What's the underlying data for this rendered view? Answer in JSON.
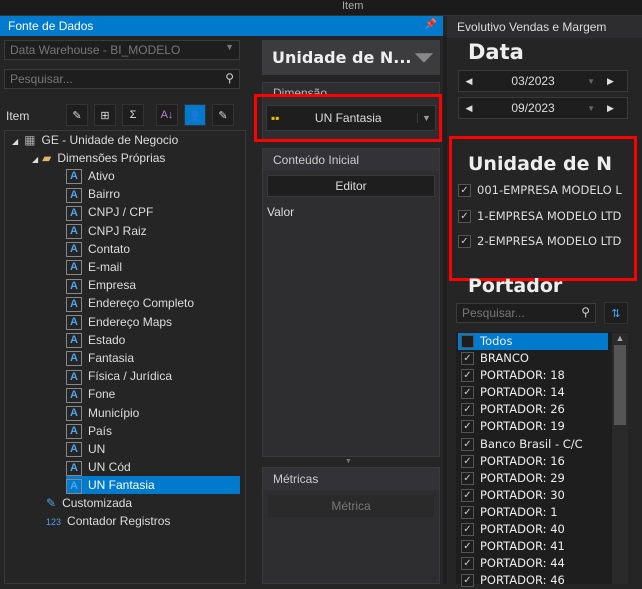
{
  "topbar": {
    "title": "Item"
  },
  "left": {
    "header": "Fonte de Dados",
    "source": "Data Warehouse - BI_MODELO",
    "search_placeholder": "Pesquisar...",
    "item_label": "Item",
    "tree": {
      "root": "GE - Unidade de Negocio",
      "folder": "Dimensões Próprias",
      "items": [
        "Ativo",
        "Bairro",
        "CNPJ / CPF",
        "CNPJ Raiz",
        "Contato",
        "E-mail",
        "Empresa",
        "Endereço Completo",
        "Endereço Maps",
        "Estado",
        "Fantasia",
        "Física / Jurídica",
        "Fone",
        "Município",
        "País",
        "UN",
        "UN Cód",
        "UN Fantasia"
      ],
      "selected": "UN Fantasia",
      "extra": [
        "Customizada",
        "Contador Registros"
      ]
    }
  },
  "middle": {
    "title": "Unidade de N...",
    "dimension_label": "Dimensão",
    "dimension_value": "UN Fantasia",
    "initial_label": "Conteúdo Inicial",
    "editor_button": "Editor",
    "value_label": "Valor",
    "metrics_label": "Métricas",
    "metric_button": "Métrica"
  },
  "right": {
    "tab": "Evolutivo Vendas e Margem",
    "data_title": "Data",
    "date_from": "03/2023",
    "date_to": "09/2023",
    "unit_title": "Unidade de N",
    "units": [
      "001-EMPRESA MODELO L",
      "1-EMPRESA MODELO LTD",
      "2-EMPRESA MODELO LTD"
    ],
    "portador_title": "Portador",
    "portador_search_placeholder": "Pesquisar...",
    "portador_all": "Todos",
    "portadores": [
      "BRANCO",
      "PORTADOR: 18",
      "PORTADOR: 14",
      "PORTADOR: 26",
      "PORTADOR: 19",
      "Banco Brasil - C/C",
      "PORTADOR: 16",
      "PORTADOR: 29",
      "PORTADOR: 30",
      "PORTADOR: 1",
      "PORTADOR: 40",
      "PORTADOR: 41",
      "PORTADOR: 44",
      "PORTADOR: 46"
    ]
  },
  "colors": {
    "accent": "#007acc",
    "highlight": "#ff0000"
  }
}
